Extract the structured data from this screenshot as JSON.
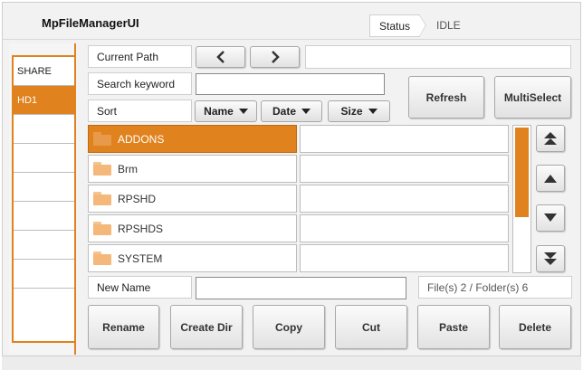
{
  "app": {
    "title": "MpFileManagerUI"
  },
  "status": {
    "label": "Status",
    "value": "IDLE"
  },
  "drives": [
    {
      "label": "SHARE",
      "selected": false
    },
    {
      "label": "HD1",
      "selected": true
    },
    {
      "label": ""
    },
    {
      "label": ""
    },
    {
      "label": ""
    },
    {
      "label": ""
    },
    {
      "label": ""
    },
    {
      "label": ""
    },
    {
      "label": ""
    }
  ],
  "path": {
    "label": "Current Path",
    "value": "",
    "back_icon": "chevron-left-icon",
    "forward_icon": "chevron-right-icon"
  },
  "search": {
    "label": "Search keyword",
    "value": ""
  },
  "sort": {
    "label": "Sort",
    "options": [
      "Name",
      "Date",
      "Size"
    ]
  },
  "actions": {
    "refresh": "Refresh",
    "multiselect": "MultiSelect"
  },
  "files": [
    {
      "name": "ADDONS",
      "selected": true
    },
    {
      "name": "Brm",
      "selected": false
    },
    {
      "name": "RPSHD",
      "selected": false
    },
    {
      "name": "RPSHDS",
      "selected": false
    },
    {
      "name": "SYSTEM",
      "selected": false
    }
  ],
  "newname": {
    "label": "New Name",
    "value": ""
  },
  "counts": {
    "text": "File(s) 2 / Folder(s) 6"
  },
  "scroll": {
    "position": 0.0,
    "visible_fraction": 0.6
  },
  "buttons": {
    "rename": "Rename",
    "createdir": "Create Dir",
    "copy": "Copy",
    "cut": "Cut",
    "paste": "Paste",
    "delete": "Delete"
  },
  "colors": {
    "accent": "#e0821e",
    "folder": "#f3b87a",
    "background": "#f2f2f2"
  }
}
